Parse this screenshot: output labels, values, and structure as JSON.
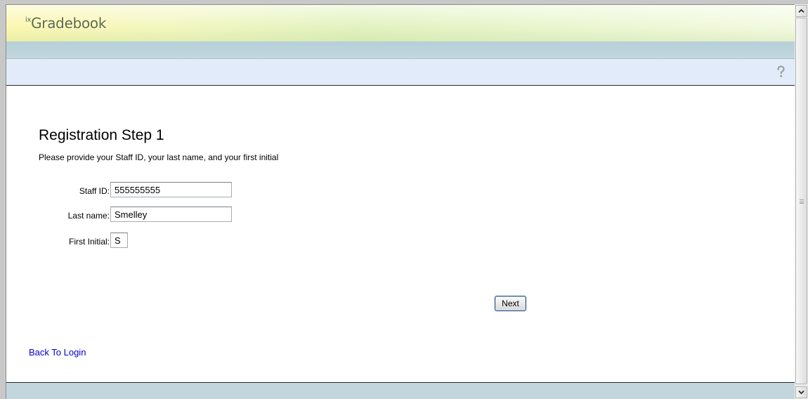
{
  "app": {
    "logo_prefix": "ix",
    "logo_text": "Gradebook"
  },
  "toolbar": {
    "help_icon": "question-mark-icon"
  },
  "registration": {
    "title": "Registration Step 1",
    "subtitle": "Please provide your Staff ID, your last name, and your first initial",
    "fields": {
      "staff_id": {
        "label": "Staff ID:",
        "value": "555555555"
      },
      "last_name": {
        "label": "Last name:",
        "value": "Smelley"
      },
      "first_initial": {
        "label": "First Initial:",
        "value": "S"
      }
    },
    "next_label": "Next",
    "back_link_label": "Back To Login"
  },
  "colors": {
    "link": "#0000cc",
    "navbar": "#c3d7de",
    "toolbar": "#e1ebfa",
    "logo_text": "#5d6b3a"
  }
}
